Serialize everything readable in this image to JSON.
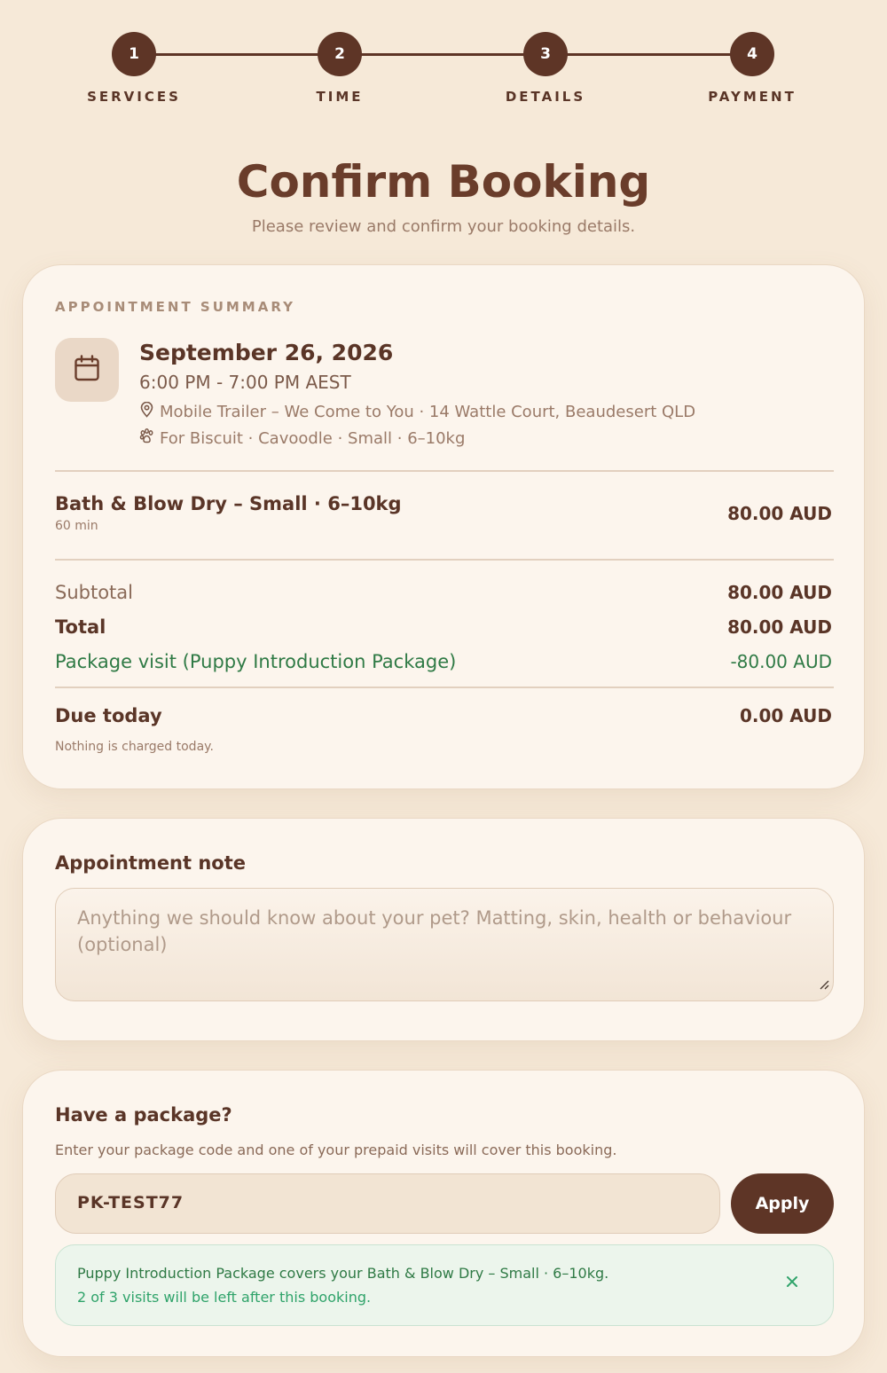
{
  "stepper": {
    "steps": [
      {
        "number": "1",
        "label": "SERVICES"
      },
      {
        "number": "2",
        "label": "TIME"
      },
      {
        "number": "3",
        "label": "DETAILS"
      },
      {
        "number": "4",
        "label": "PAYMENT"
      }
    ]
  },
  "header": {
    "title": "Confirm Booking",
    "subtitle": "Please review and confirm your booking details."
  },
  "summary": {
    "eyebrow": "APPOINTMENT SUMMARY",
    "date": "September 26, 2026",
    "time": "6:00 PM - 7:00 PM AEST",
    "location": "Mobile Trailer – We Come to You · 14 Wattle Court, Beaudesert QLD",
    "pet": "For Biscuit · Cavoodle · Small · 6–10kg",
    "service": {
      "name": "Bath & Blow Dry – Small · 6–10kg",
      "duration": "60 min",
      "price": "80.00 AUD"
    },
    "subtotal_label": "Subtotal",
    "subtotal_amount": "80.00 AUD",
    "total_label": "Total",
    "total_amount": "80.00 AUD",
    "package_label": "Package visit (Puppy Introduction Package)",
    "package_amount": "-80.00 AUD",
    "due_label": "Due today",
    "due_amount": "0.00 AUD",
    "due_note": "Nothing is charged today."
  },
  "note": {
    "heading": "Appointment note",
    "placeholder": "Anything we should know about your pet? Matting, skin, health or behaviour (optional)"
  },
  "package": {
    "heading": "Have a package?",
    "description": "Enter your package code and one of your prepaid visits will cover this booking.",
    "code_value": "PK-TEST77",
    "apply_label": "Apply",
    "alert_line1": "Puppy Introduction Package covers your Bath & Blow Dry – Small · 6–10kg.",
    "alert_line2": "2 of 3 visits will be left after this booking."
  },
  "colors": {
    "background": "#f6e9d8",
    "brand": "#5e3526",
    "card": "#fcf5ed",
    "success": "#2f7a45"
  },
  "icons": {
    "date": "calendar-icon",
    "location": "map-pin-icon",
    "pet": "paw-icon",
    "alert_close": "close-icon"
  }
}
